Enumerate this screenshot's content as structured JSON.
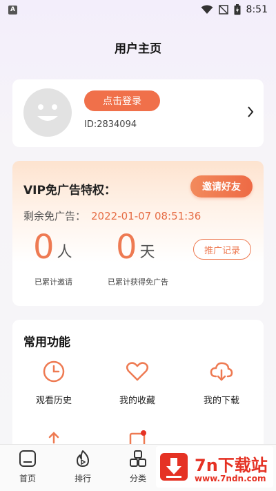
{
  "status_bar": {
    "time": "8:51",
    "app_badge": "A"
  },
  "page": {
    "title": "用户主页"
  },
  "user_card": {
    "login_label": "点击登录",
    "user_id": "ID:2834094"
  },
  "vip": {
    "title": "VIP免广告特权：",
    "invite_label": "邀请好友",
    "remain_label": "剩余免广告：",
    "remain_time": "2022-01-07 08:51:36",
    "invited_count": "0",
    "invited_unit": "人",
    "invited_caption": "已累计邀请",
    "days_count": "0",
    "days_unit": "天",
    "days_caption": "已累计获得免广告",
    "promo_label": "推广记录"
  },
  "functions": {
    "title": "常用功能",
    "items": [
      {
        "label": "观看历史",
        "icon": "clock-icon"
      },
      {
        "label": "我的收藏",
        "icon": "heart-icon"
      },
      {
        "label": "我的下载",
        "icon": "cloud-download-icon"
      }
    ]
  },
  "tabbar": {
    "items": [
      {
        "label": "首页",
        "icon": "home-icon"
      },
      {
        "label": "排行",
        "icon": "flame-icon"
      },
      {
        "label": "分类",
        "icon": "grid-icon"
      }
    ]
  },
  "watermark": {
    "title": "7n下载站",
    "url": "www.7ndn.com"
  },
  "colors": {
    "accent": "#ee7a52",
    "login_button": "#f0704a",
    "watermark_red": "#e53224"
  }
}
